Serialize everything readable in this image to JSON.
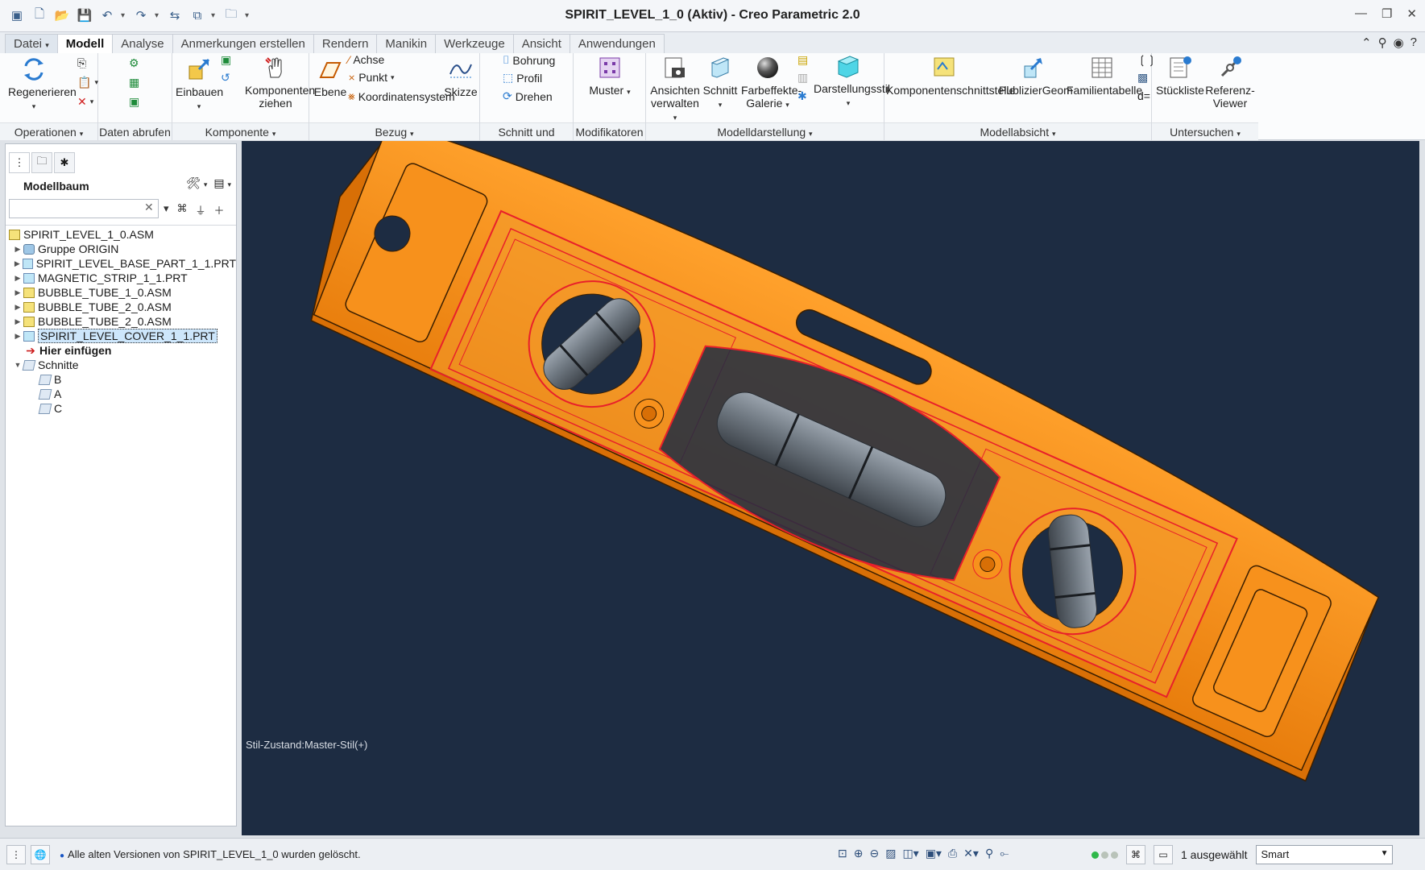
{
  "window": {
    "title": "SPIRIT_LEVEL_1_0 (Aktiv) - Creo Parametric 2.0"
  },
  "tabs": [
    "Datei",
    "Modell",
    "Analyse",
    "Anmerkungen erstellen",
    "Rendern",
    "Manikin",
    "Werkzeuge",
    "Ansicht",
    "Anwendungen"
  ],
  "ribbon": {
    "groups": {
      "operationen": "Operationen",
      "daten_abrufen": "Daten abrufen",
      "komponente": "Komponente",
      "bezug": "Bezug",
      "schnitt": "Schnitt und Fläche",
      "modifikatoren": "Modifikatoren",
      "modelldarstellung": "Modelldarstellung",
      "modellabsicht": "Modellabsicht",
      "untersuchen": "Untersuchen"
    },
    "buttons": {
      "regenerieren": "Regenerieren",
      "einbauen": "Einbauen",
      "komponenten_ziehen_1": "Komponenten",
      "komponenten_ziehen_2": "ziehen",
      "ebene": "Ebene",
      "achse": "Achse",
      "punkt": "Punkt",
      "koordinatensystem": "Koordinatensystem",
      "skizze": "Skizze",
      "bohrung": "Bohrung",
      "profil": "Profil",
      "drehen": "Drehen",
      "muster": "Muster",
      "ansichten_1": "Ansichten",
      "ansichten_2": "verwalten",
      "schnitt": "Schnitt",
      "farbeffekte_1": "Farbeffekte-",
      "farbeffekte_2": "Galerie",
      "darstellungsstil": "Darstellungsstil",
      "komponentenschnittstelle": "Komponentenschnittstelle",
      "publiziergeom": "PublizierGeom",
      "familientabelle": "Familientabelle",
      "stueckliste": "Stückliste",
      "referenz_1": "Referenz-",
      "referenz_2": "Viewer"
    }
  },
  "model_tree": {
    "title": "Modellbaum",
    "search_placeholder": "",
    "items": [
      {
        "label": "SPIRIT_LEVEL_1_0.ASM"
      },
      {
        "label": "Gruppe ORIGIN"
      },
      {
        "label": "SPIRIT_LEVEL_BASE_PART_1_1.PRT"
      },
      {
        "label": "MAGNETIC_STRIP_1_1.PRT"
      },
      {
        "label": "BUBBLE_TUBE_1_0.ASM"
      },
      {
        "label": "BUBBLE_TUBE_2_0.ASM"
      },
      {
        "label": "BUBBLE_TUBE_2_0.ASM"
      },
      {
        "label": "SPIRIT_LEVEL_COVER_1_1.PRT"
      },
      {
        "label": "Hier einfügen"
      },
      {
        "label": "Schnitte"
      },
      {
        "label": "B"
      },
      {
        "label": "A"
      },
      {
        "label": "C"
      }
    ]
  },
  "viewport": {
    "style_state": "Stil-Zustand:Master-Stil(+)"
  },
  "status": {
    "message": "Alle alten Versionen von SPIRIT_LEVEL_1_0 wurden gelöscht.",
    "selected_count": "1 ausgewählt",
    "filter": "Smart"
  },
  "colors": {
    "model_orange": "#f08a12",
    "section_red": "#e8202a",
    "background": "#1d2c42"
  }
}
